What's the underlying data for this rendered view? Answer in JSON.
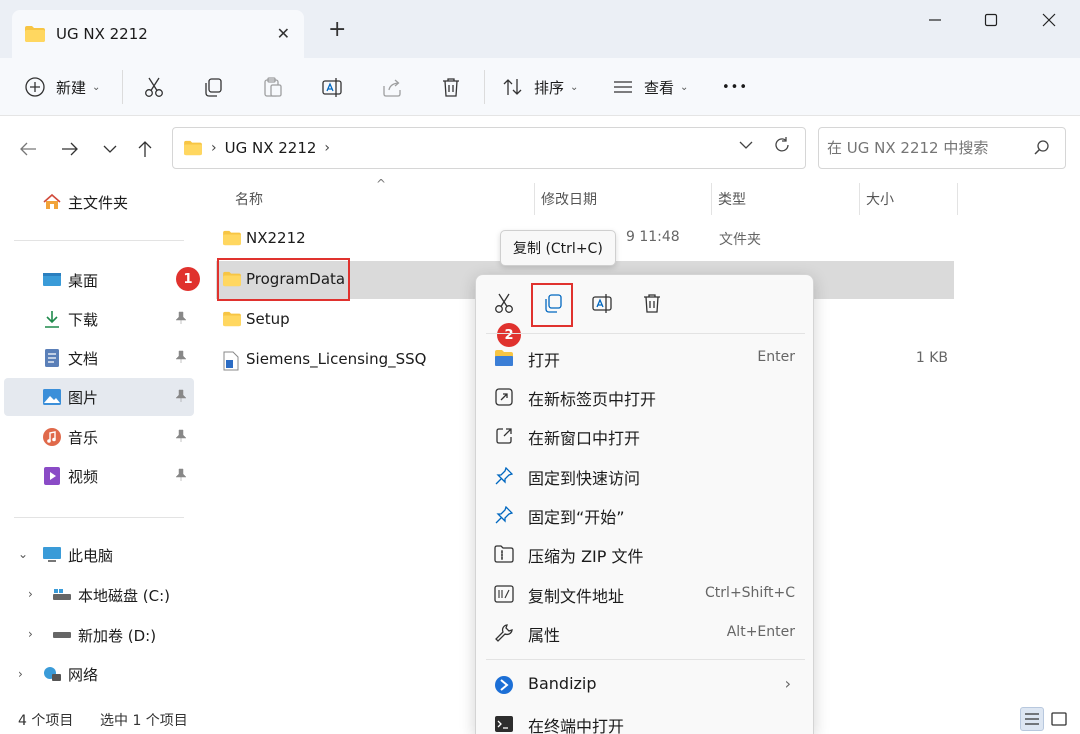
{
  "window": {
    "tab_title": "UG NX 2212",
    "new_tab": "+",
    "close_tab": "✕"
  },
  "toolbar": {
    "new_label": "新建",
    "sort_label": "排序",
    "view_label": "查看",
    "more_label": "•••"
  },
  "address": {
    "path": "UG NX 2212",
    "search_placeholder": "在 UG NX 2212 中搜索"
  },
  "sidebar": {
    "home": "主文件夹",
    "items": [
      {
        "label": "桌面",
        "icon": "desktop-icon"
      },
      {
        "label": "下载",
        "icon": "download-icon"
      },
      {
        "label": "文档",
        "icon": "document-icon"
      },
      {
        "label": "图片",
        "icon": "picture-icon"
      },
      {
        "label": "音乐",
        "icon": "music-icon"
      },
      {
        "label": "视频",
        "icon": "video-icon"
      }
    ],
    "this_pc": "此电脑",
    "drives": [
      "本地磁盘 (C:)",
      "新加卷 (D:)"
    ],
    "network": "网络"
  },
  "columns": {
    "name": "名称",
    "date": "修改日期",
    "type": "类型",
    "size": "大小"
  },
  "files": [
    {
      "name": "NX2212",
      "date": "9 11:48",
      "type": "文件夹",
      "size": ""
    },
    {
      "name": "ProgramData",
      "date": "",
      "type": "",
      "size": ""
    },
    {
      "name": "Setup",
      "date": "",
      "type": "",
      "size": ""
    },
    {
      "name": "Siemens_Licensing_SSQ",
      "date": "",
      "type": "",
      "size": "1 KB"
    }
  ],
  "tooltip": "复制 (Ctrl+C)",
  "badges": [
    "1",
    "2"
  ],
  "context_menu": {
    "items": [
      {
        "label": "打开",
        "shortcut": "Enter",
        "icon": "folder-open-icon"
      },
      {
        "label": "在新标签页中打开",
        "shortcut": "",
        "icon": "new-tab-icon"
      },
      {
        "label": "在新窗口中打开",
        "shortcut": "",
        "icon": "new-window-icon"
      },
      {
        "label": "固定到快速访问",
        "shortcut": "",
        "icon": "pin-icon"
      },
      {
        "label": "固定到“开始”",
        "shortcut": "",
        "icon": "pin-start-icon"
      },
      {
        "label": "压缩为 ZIP 文件",
        "shortcut": "",
        "icon": "zip-icon"
      },
      {
        "label": "复制文件地址",
        "shortcut": "Ctrl+Shift+C",
        "icon": "copy-path-icon"
      },
      {
        "label": "属性",
        "shortcut": "Alt+Enter",
        "icon": "properties-icon"
      }
    ],
    "extra_items": [
      {
        "label": "Bandizip",
        "icon": "bandizip-icon"
      },
      {
        "label": "在终端中打开",
        "icon": "terminal-icon"
      }
    ]
  },
  "status": {
    "count": "4 个项目",
    "selected": "选中 1 个项目"
  },
  "colors": {
    "accent": "#0067c0",
    "folder": "#f7c544",
    "highlight_red": "#e0322e"
  }
}
